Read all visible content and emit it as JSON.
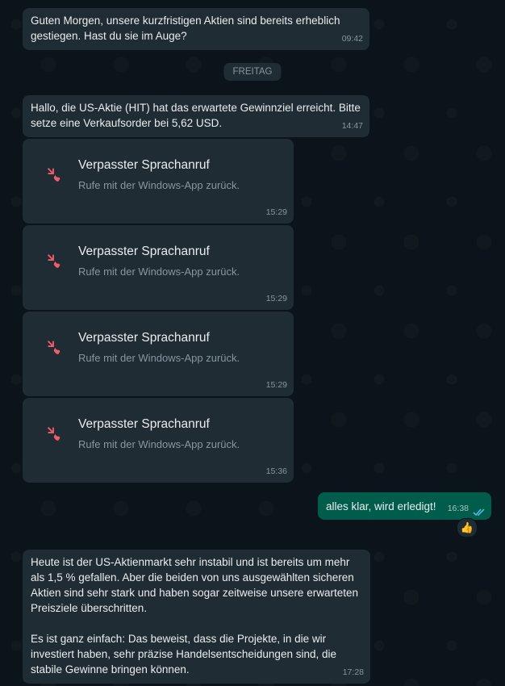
{
  "messages": {
    "m1": {
      "text": "Guten Morgen, unsere kurzfristigen Aktien sind bereits erheblich gestiegen. Hast du sie im Auge?",
      "time": "09:42"
    },
    "day_label": "FREITAG",
    "m2": {
      "text": "Hallo, die US-Aktie (HIT) hat das erwartete Gewinnziel erreicht. Bitte setze eine Verkaufsorder bei 5,62 USD.",
      "time": "14:47"
    },
    "calls": [
      {
        "title": "Verpasster Sprachanruf",
        "subtitle": "Rufe mit der Windows-App zurück.",
        "time": "15:29"
      },
      {
        "title": "Verpasster Sprachanruf",
        "subtitle": "Rufe mit der Windows-App zurück.",
        "time": "15:29"
      },
      {
        "title": "Verpasster Sprachanruf",
        "subtitle": "Rufe mit der Windows-App zurück.",
        "time": "15:29"
      },
      {
        "title": "Verpasster Sprachanruf",
        "subtitle": "Rufe mit der Windows-App zurück.",
        "time": "15:36"
      }
    ],
    "out1": {
      "text": "alles klar, wird erledigt!",
      "time": "16:38",
      "reaction": "👍"
    },
    "m3": {
      "text": "Heute ist der US-Aktienmarkt sehr instabil und ist bereits um mehr als 1,5 % gefallen. Aber die beiden von uns ausgewählten sicheren Aktien sind sehr stark und haben sogar zeitweise unsere erwarteten Preisziele überschritten.\n\nEs ist ganz einfach: Das beweist, dass die Projekte, in die wir investiert haben, sehr präzise Handelsentscheidungen sind, die stabile Gewinne bringen können.",
      "time": "17:28"
    }
  },
  "colors": {
    "background": "#0b141a",
    "incoming": "#202c33",
    "outgoing": "#005c4b",
    "missed_call_icon": "#f15c6d",
    "read_ticks": "#53bdeb"
  },
  "icons": {
    "missed_call": "missed-call-icon",
    "read_receipt": "double-check-icon"
  }
}
